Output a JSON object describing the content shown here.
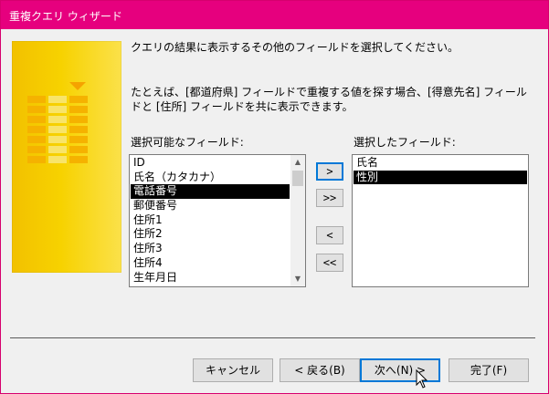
{
  "window": {
    "title": "重複クエリ ウィザード"
  },
  "instructions": {
    "line1": "クエリの結果に表示するその他のフィールドを選択してください。",
    "line2": "たとえば、[都道府県] フィールドで重複する値を探す場合、[得意先名] フィールドと [住所] フィールドを共に表示できます。"
  },
  "available_fields": {
    "label": "選択可能なフィールド:",
    "items": [
      {
        "label": "ID",
        "selected": false
      },
      {
        "label": "氏名（カタカナ）",
        "selected": false
      },
      {
        "label": "電話番号",
        "selected": true
      },
      {
        "label": "郵便番号",
        "selected": false
      },
      {
        "label": "住所1",
        "selected": false
      },
      {
        "label": "住所2",
        "selected": false
      },
      {
        "label": "住所3",
        "selected": false
      },
      {
        "label": "住所4",
        "selected": false
      },
      {
        "label": "生年月日",
        "selected": false
      }
    ]
  },
  "selected_fields": {
    "label": "選択したフィールド:",
    "items": [
      {
        "label": "氏名",
        "selected": false
      },
      {
        "label": "性別",
        "selected": true
      }
    ]
  },
  "move_buttons": {
    "add_one": ">",
    "add_all": ">>",
    "remove_one": "<",
    "remove_all": "<<"
  },
  "buttons": {
    "cancel": "キャンセル",
    "back": "< 戻る(B)",
    "next": "次へ(N) >",
    "finish": "完了(F)"
  }
}
